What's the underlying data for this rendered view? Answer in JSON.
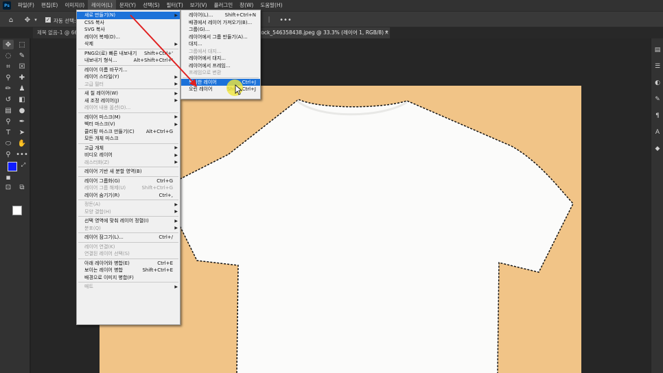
{
  "menubar": {
    "items": [
      "파일(F)",
      "편집(E)",
      "이미지(I)",
      "레이어(L)",
      "문자(Y)",
      "선택(S)",
      "필터(T)",
      "보기(V)",
      "플러그인",
      "창(W)",
      "도움말(H)"
    ],
    "active_index": 3
  },
  "options": {
    "auto_select_label": "자동 선택:"
  },
  "tabs": [
    {
      "label": "제목 없음-1 @ 66.7"
    },
    {
      "label": "eStock_546358438.jpeg @ 33.3% (레이어 1, RGB/8) *"
    }
  ],
  "colors": {
    "foreground": "#0f1dff",
    "background": "#ffffff",
    "canvas": "#f1c487",
    "highlight": "#1c72d9"
  },
  "layer_menu": [
    {
      "label": "새로 만들기(N)",
      "submenu": true,
      "highlighted": true
    },
    {
      "label": "CSS 복사"
    },
    {
      "label": "SVG 복사"
    },
    {
      "label": "레이어 복제(D)..."
    },
    {
      "label": "삭제",
      "submenu": true
    },
    {
      "sep": true
    },
    {
      "label": "PNG으(로) 빠른 내보내기",
      "shortcut": "Shift+Ctrl+'"
    },
    {
      "label": "내보내기 형식...",
      "shortcut": "Alt+Shift+Ctrl+'"
    },
    {
      "sep": true
    },
    {
      "label": "레이어 이름 바꾸기..."
    },
    {
      "label": "레이어 스타일(Y)",
      "submenu": true
    },
    {
      "label": "고급 필터",
      "submenu": true,
      "disabled": true
    },
    {
      "sep": true
    },
    {
      "label": "새 칠 레이어(W)",
      "submenu": true
    },
    {
      "label": "새 조정 레이어(J)",
      "submenu": true
    },
    {
      "label": "레이어 내용 옵션(O)...",
      "disabled": true
    },
    {
      "sep": true
    },
    {
      "label": "레이어 마스크(M)",
      "submenu": true
    },
    {
      "label": "벡터 마스크(V)",
      "submenu": true
    },
    {
      "label": "클리핑 마스크 만들기(C)",
      "shortcut": "Alt+Ctrl+G"
    },
    {
      "label": "모든 개체 마스크"
    },
    {
      "sep": true
    },
    {
      "label": "고급 개체",
      "submenu": true
    },
    {
      "label": "비디오 레이어",
      "submenu": true
    },
    {
      "label": "래스터화(Z)",
      "submenu": true,
      "disabled": true
    },
    {
      "sep": true
    },
    {
      "label": "레이어 기반 새 분할 영역(B)"
    },
    {
      "sep": true
    },
    {
      "label": "레이어 그룹화(G)",
      "shortcut": "Ctrl+G"
    },
    {
      "label": "레이어 그룹 해제(U)",
      "shortcut": "Shift+Ctrl+G",
      "disabled": true
    },
    {
      "label": "레이어 숨기기(R)",
      "shortcut": "Ctrl+,"
    },
    {
      "sep": true
    },
    {
      "label": "정돈(A)",
      "submenu": true,
      "disabled": true
    },
    {
      "label": "모양 결합(H)",
      "submenu": true,
      "disabled": true
    },
    {
      "sep": true
    },
    {
      "label": "선택 영역에 맞춰 레이어 정렬(I)",
      "submenu": true
    },
    {
      "label": "분포(Q)",
      "submenu": true,
      "disabled": true
    },
    {
      "sep": true
    },
    {
      "label": "레이어 잠그기(L)...",
      "shortcut": "Ctrl+/"
    },
    {
      "sep": true
    },
    {
      "label": "레이어 연결(K)",
      "disabled": true
    },
    {
      "label": "연결된 레이어 선택(S)",
      "disabled": true
    },
    {
      "sep": true
    },
    {
      "label": "아래 레이어와 병합(E)",
      "shortcut": "Ctrl+E"
    },
    {
      "label": "보이는 레이어 병합",
      "shortcut": "Shift+Ctrl+E"
    },
    {
      "label": "배경으로 이미지 병합(F)"
    },
    {
      "sep": true
    },
    {
      "label": "매트",
      "submenu": true,
      "disabled": true
    }
  ],
  "new_submenu": [
    {
      "label": "레이어(L)...",
      "shortcut": "Shift+Ctrl+N"
    },
    {
      "label": "배경에서 레이어 가져오기(B)..."
    },
    {
      "label": "그룹(G)..."
    },
    {
      "label": "레이어에서 그룹 만들기(A)..."
    },
    {
      "label": "대지..."
    },
    {
      "label": "그룹에서 대지...",
      "disabled": true
    },
    {
      "label": "레이어에서 대지..."
    },
    {
      "label": "레이어에서 프레임..."
    },
    {
      "label": "프레임으로 변환",
      "disabled": true
    },
    {
      "sep": true
    },
    {
      "label": "복사한 레이어",
      "shortcut": "Ctrl+J",
      "highlighted": true
    },
    {
      "label": "오린 레이어",
      "shortcut": "Shift+Ctrl+J"
    }
  ]
}
